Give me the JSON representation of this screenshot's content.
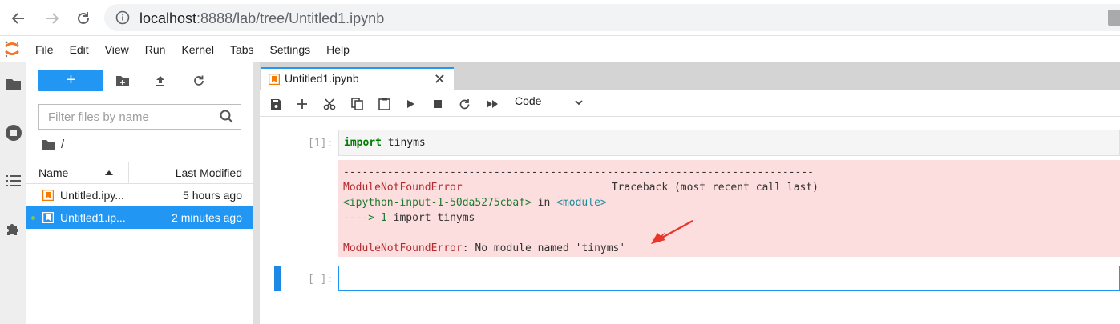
{
  "browser": {
    "url_host": "localhost",
    "url_rest": ":8888/lab/tree/Untitled1.ipynb"
  },
  "menu": [
    "File",
    "Edit",
    "View",
    "Run",
    "Kernel",
    "Tabs",
    "Settings",
    "Help"
  ],
  "filebrowser": {
    "new_label": "+",
    "filter_placeholder": "Filter files by name",
    "breadcrumb": "/",
    "col_name": "Name",
    "col_modified": "Last Modified",
    "files": [
      {
        "name": "Untitled.ipy...",
        "modified": "5 hours ago",
        "selected": false
      },
      {
        "name": "Untitled1.ip...",
        "modified": "2 minutes ago",
        "selected": true
      }
    ]
  },
  "tab": {
    "label": "Untitled1.ipynb",
    "close": "✕"
  },
  "toolbar": {
    "cell_type": "Code"
  },
  "cells": {
    "cell1_prompt": "[1]:",
    "cell1_code_kw": "import",
    "cell1_code_rest": " tinyms",
    "out_dashes": "---------------------------------------------------------------------------",
    "out_err_name": "ModuleNotFoundError",
    "out_traceback": "Traceback (most recent call last)",
    "out_input": "<ipython-input-1-50da5275cbaf>",
    "out_in": " in ",
    "out_module": "<module>",
    "out_arrow": "----> 1",
    "out_import_rest": " import tinyms",
    "out_err_name2": "ModuleNotFoundError",
    "out_err_msg": ": No module named 'tinyms'",
    "cell2_prompt": "[ ]:"
  },
  "colors": {
    "accent": "#2196f3",
    "error_bg": "#fddede",
    "notebook_icon": "#f57c00"
  }
}
